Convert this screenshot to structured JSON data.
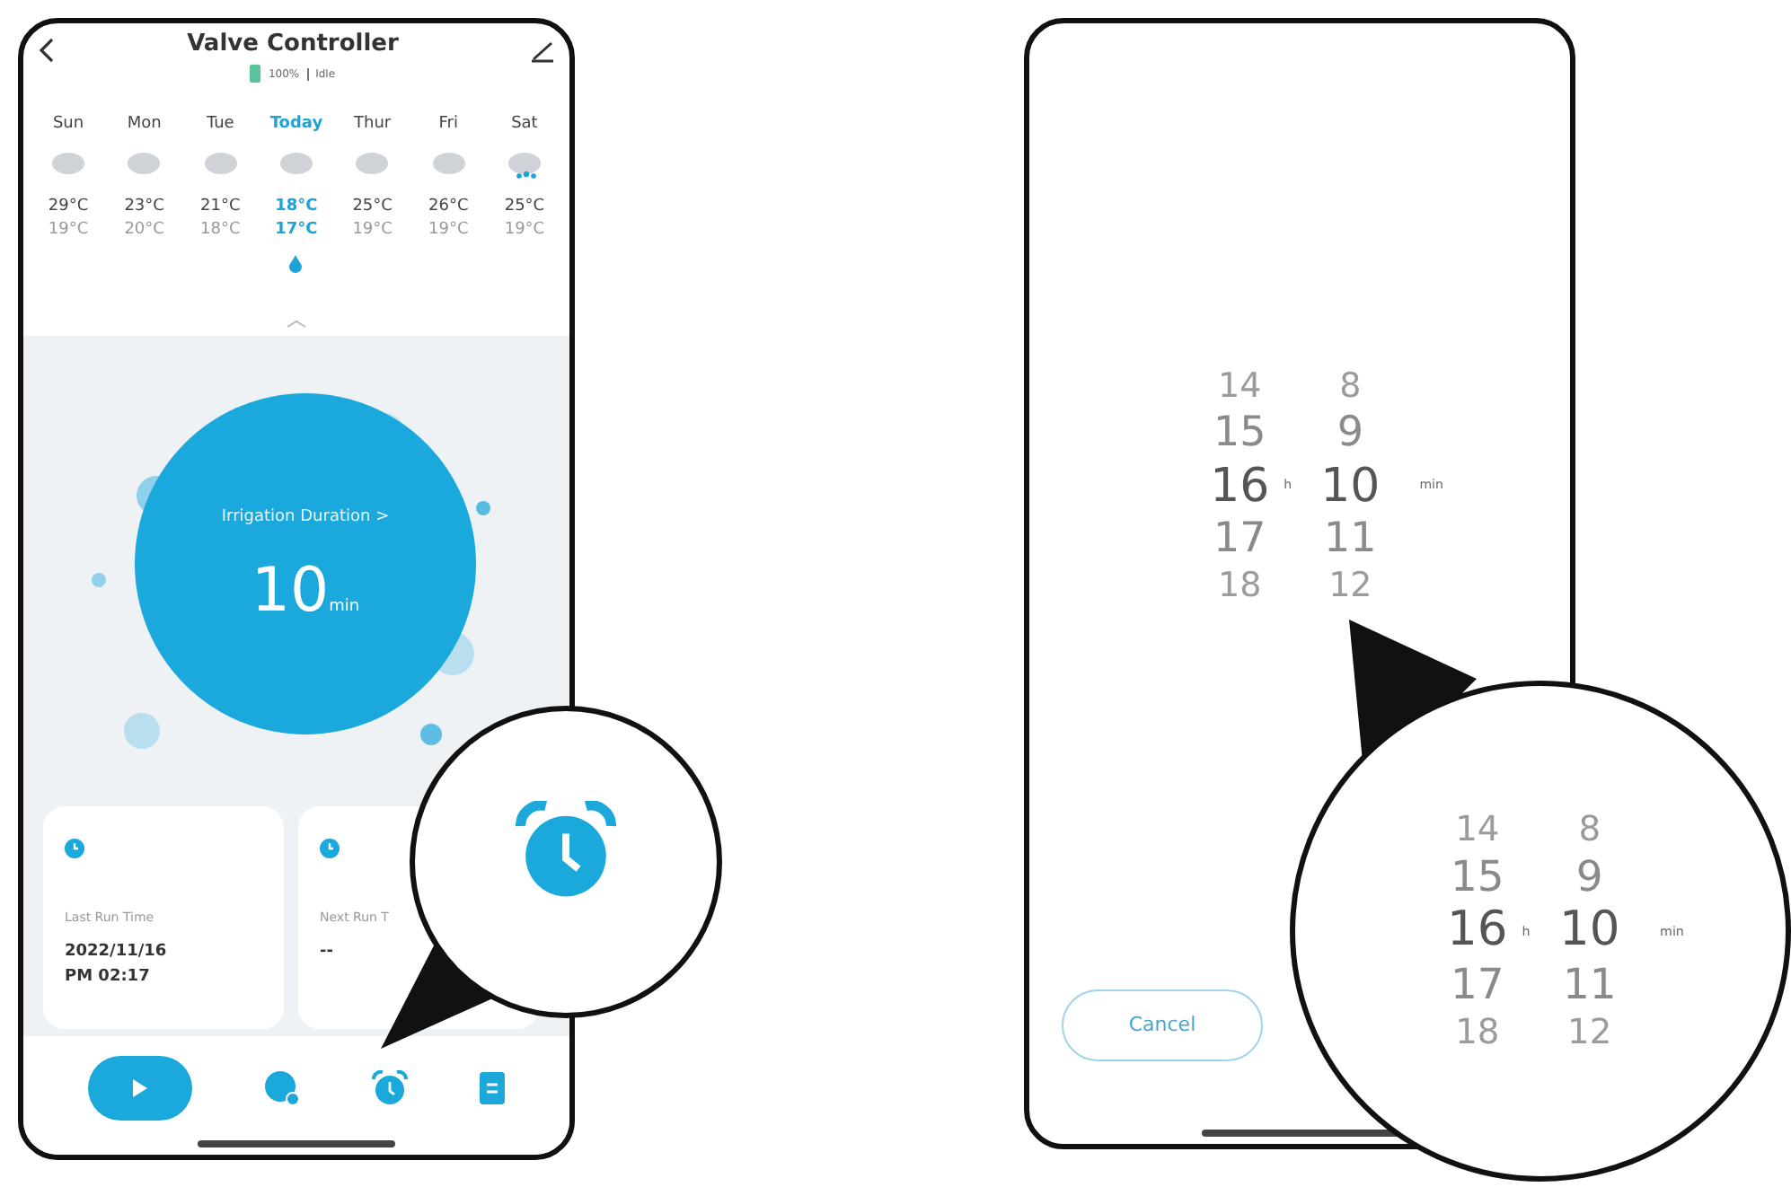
{
  "left_phone": {
    "title": "Valve Controller",
    "battery": {
      "level": 1,
      "reading": "100%"
    },
    "status": "Idle",
    "forecast": [
      {
        "day": "Sun",
        "kind": "cloud",
        "high": "29°C",
        "low": "19°C",
        "selected": false,
        "drop": false
      },
      {
        "day": "Mon",
        "kind": "cloud",
        "high": "23°C",
        "low": "20°C",
        "selected": false,
        "drop": false
      },
      {
        "day": "Tue",
        "kind": "cloud",
        "high": "21°C",
        "low": "18°C",
        "selected": false,
        "drop": false
      },
      {
        "day": "Today",
        "kind": "cloud",
        "high": "18°C",
        "low": "17°C",
        "selected": true,
        "drop": true
      },
      {
        "day": "Thur",
        "kind": "cloud",
        "high": "25°C",
        "low": "19°C",
        "selected": false,
        "drop": false
      },
      {
        "day": "Fri",
        "kind": "cloud",
        "high": "26°C",
        "low": "19°C",
        "selected": false,
        "drop": false
      },
      {
        "day": "Sat",
        "kind": "rain",
        "high": "25°C",
        "low": "19°C",
        "selected": false,
        "drop": false
      }
    ],
    "duration": {
      "label": "Irrigation Duration >",
      "value": "10",
      "unit": "min"
    },
    "cards": [
      {
        "label": "Last Run Time",
        "lines": [
          "2022/11/16",
          "PM 02:17"
        ]
      },
      {
        "label": "Next Run T",
        "lines": [
          "--"
        ]
      }
    ],
    "nav": [
      {
        "kind": "play"
      },
      {
        "kind": "history"
      },
      {
        "kind": "alarm"
      },
      {
        "kind": "log"
      }
    ]
  },
  "left_magnifier": {
    "kind": "alarm"
  },
  "right_phone": {
    "hours": [
      {
        "value": "14",
        "selected": false
      },
      {
        "value": "15",
        "selected": false
      },
      {
        "value": "16",
        "selected": true
      },
      {
        "value": "17",
        "selected": false
      },
      {
        "value": "18",
        "selected": false
      }
    ],
    "hour_unit": "h",
    "minutes": [
      {
        "value": "8",
        "selected": false
      },
      {
        "value": "9",
        "selected": false
      },
      {
        "value": "10",
        "selected": true
      },
      {
        "value": "11",
        "selected": false
      },
      {
        "value": "12",
        "selected": false
      }
    ],
    "minute_unit": "min",
    "cancel": "Cancel"
  },
  "right_magnifier": {
    "hours": [
      {
        "value": "14",
        "selected": false
      },
      {
        "value": "15",
        "selected": false
      },
      {
        "value": "16",
        "selected": true
      },
      {
        "value": "17",
        "selected": false
      },
      {
        "value": "18",
        "selected": false
      }
    ],
    "hour_unit": "h",
    "minutes": [
      {
        "value": "8",
        "selected": false
      },
      {
        "value": "9",
        "selected": false
      },
      {
        "value": "10",
        "selected": true
      },
      {
        "value": "11",
        "selected": false
      },
      {
        "value": "12",
        "selected": false
      }
    ],
    "minute_unit": "min"
  }
}
